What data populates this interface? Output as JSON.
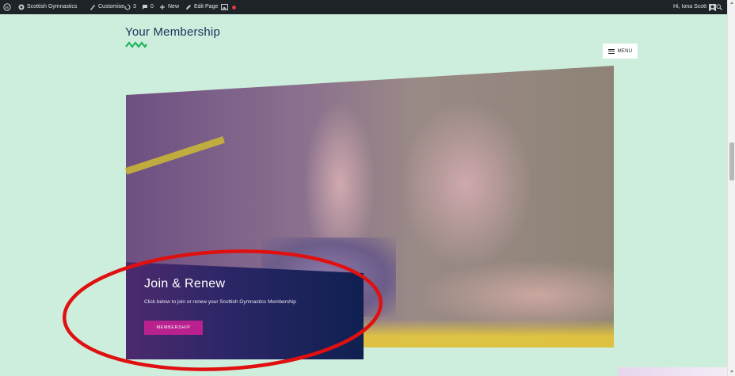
{
  "adminbar": {
    "site_name": "Scottish Gymnastics",
    "customise": "Customise",
    "updates_count": "3",
    "comments_count": "0",
    "new": "New",
    "edit_page": "Edit Page",
    "greeting": "Hi, Iona Scott"
  },
  "header": {
    "title": "Your Membership",
    "menu_label": "MENU"
  },
  "hero": {
    "cta_title": "Join & Renew",
    "cta_text": "Click below to join or renew your Scottish Gymnastics Membership",
    "cta_button": "MEMBERSHIP"
  },
  "colors": {
    "background": "#cdeedd",
    "title": "#1e2f5a",
    "zigzag": "#1fb55a",
    "cta_button": "#b8218e",
    "annotation_circle": "#e01010",
    "adminbar": "#1d2327"
  },
  "icons": [
    "wordpress-icon",
    "dashboard-icon",
    "brush-icon",
    "updates-icon",
    "comments-icon",
    "plus-icon",
    "pencil-icon",
    "image-icon",
    "record-icon",
    "avatar-icon",
    "search-icon",
    "menu-icon"
  ]
}
